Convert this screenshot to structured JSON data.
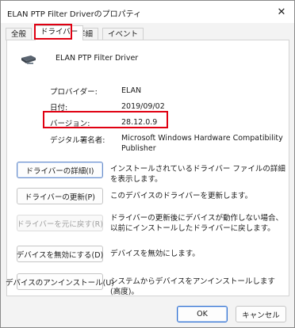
{
  "window": {
    "title": "ELAN PTP Filter Driverのプロパティ",
    "close_glyph": "✕"
  },
  "tabs": [
    {
      "label": "全般",
      "active": false
    },
    {
      "label": "ドライバー",
      "active": true
    },
    {
      "label": "詳細",
      "active": false
    },
    {
      "label": "イベント",
      "active": false
    }
  ],
  "device": {
    "name": "ELAN PTP Filter Driver",
    "icon": "touchpad-device-icon"
  },
  "properties": {
    "provider_label": "プロバイダー:",
    "provider_value": "ELAN",
    "date_label": "日付:",
    "date_value": "2019/09/02",
    "version_label": "バージョン:",
    "version_value": "28.12.0.9",
    "signer_label": "デジタル署名者:",
    "signer_value_line1": "Microsoft Windows Hardware Compatibility",
    "signer_value_line2": "Publisher"
  },
  "actions": [
    {
      "label": "ドライバーの詳細(I)",
      "desc": "インストールされているドライバー ファイルの詳細を表示します。",
      "enabled": true
    },
    {
      "label": "ドライバーの更新(P)",
      "desc": "このデバイスのドライバーを更新します。",
      "enabled": true
    },
    {
      "label": "ドライバーを元に戻す(R)",
      "desc": "ドライバーの更新後にデバイスが動作しない場合、以前にインストールしたドライバーに戻します。",
      "enabled": false
    },
    {
      "label": "デバイスを無効にする(D)",
      "desc": "デバイスを無効にします。",
      "enabled": true
    },
    {
      "label": "デバイスのアンインストール(U)",
      "desc": "システムからデバイスをアンインストールします (高度)。",
      "enabled": true
    }
  ],
  "footer": {
    "ok_label": "OK",
    "cancel_label": "キャンセル"
  },
  "colors": {
    "highlight": "#e00012"
  }
}
